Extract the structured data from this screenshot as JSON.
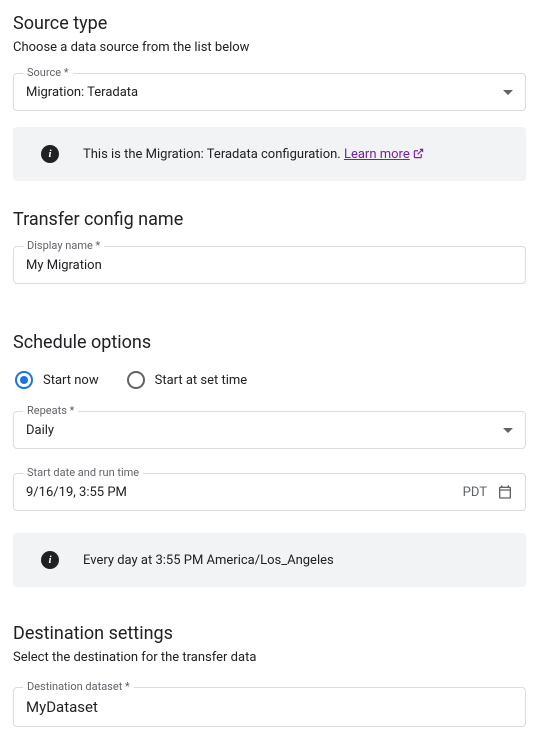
{
  "sourceType": {
    "title": "Source type",
    "desc": "Choose a data source from the list below",
    "sourceLabel": "Source *",
    "sourceValue": "Migration: Teradata",
    "infoText": "This is the Migration: Teradata configuration. ",
    "learnMore": "Learn more"
  },
  "transferConfig": {
    "title": "Transfer config name",
    "displayNameLabel": "Display name *",
    "displayNameValue": "My Migration"
  },
  "schedule": {
    "title": "Schedule options",
    "startNow": "Start now",
    "startAtSetTime": "Start at set time",
    "repeatsLabel": "Repeats *",
    "repeatsValue": "Daily",
    "startDateLabel": "Start date and run time",
    "startDateValue": "9/16/19, 3:55 PM",
    "timezone": "PDT",
    "infoText": "Every day at 3:55 PM America/Los_Angeles"
  },
  "destination": {
    "title": "Destination settings",
    "desc": "Select the destination for the transfer data",
    "datasetLabel": "Destination dataset *",
    "datasetValue": "MyDataset"
  }
}
